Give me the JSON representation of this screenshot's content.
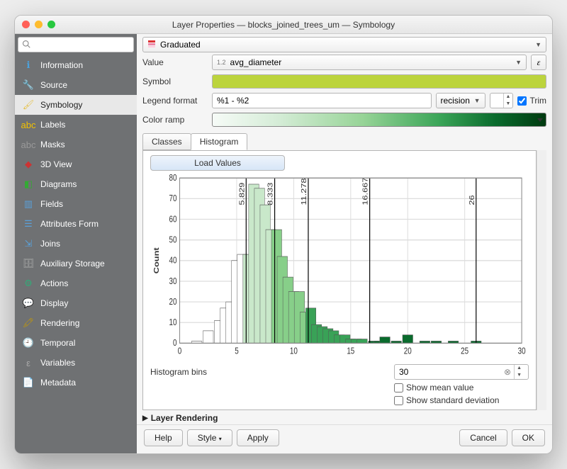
{
  "window": {
    "title": "Layer Properties — blocks_joined_trees_um — Symbology"
  },
  "search": {
    "placeholder": ""
  },
  "sidebar": {
    "items": [
      {
        "label": "Information",
        "icon": "ℹ",
        "bg": "#4aa3df"
      },
      {
        "label": "Source",
        "icon": "🔧",
        "bg": "#888"
      },
      {
        "label": "Symbology",
        "icon": "🖌",
        "bg": "#e6c24a",
        "selected": true
      },
      {
        "label": "Labels",
        "icon": "abc",
        "bg": "#f3c200"
      },
      {
        "label": "Masks",
        "icon": "abc",
        "bg": "#999"
      },
      {
        "label": "3D View",
        "icon": "◆",
        "bg": "#c33"
      },
      {
        "label": "Diagrams",
        "icon": "◧",
        "bg": "#3a3"
      },
      {
        "label": "Fields",
        "icon": "▥",
        "bg": "#5aa0d8"
      },
      {
        "label": "Attributes Form",
        "icon": "☰",
        "bg": "#5aa0d8"
      },
      {
        "label": "Joins",
        "icon": "⇲",
        "bg": "#5aa0d8"
      },
      {
        "label": "Auxiliary Storage",
        "icon": "🗄",
        "bg": "#aaa"
      },
      {
        "label": "Actions",
        "icon": "⚙",
        "bg": "#3a7"
      },
      {
        "label": "Display",
        "icon": "💬",
        "bg": "#f0b000"
      },
      {
        "label": "Rendering",
        "icon": "🖍",
        "bg": "#c89b00"
      },
      {
        "label": "Temporal",
        "icon": "🕘",
        "bg": "#aaa"
      },
      {
        "label": "Variables",
        "icon": "ε",
        "bg": "#aaa"
      },
      {
        "label": "Metadata",
        "icon": "📄",
        "bg": "#aaa"
      }
    ]
  },
  "renderer": {
    "type": "Graduated"
  },
  "rows": {
    "value_label": "Value",
    "value_field": "avg_diameter",
    "value_prefix": "1.2",
    "symbol_label": "Symbol",
    "legend_label": "Legend format",
    "legend_value": "%1 - %2",
    "precision_combo": "recision",
    "precision_value": "",
    "trim_label": "Trim",
    "ramp_label": "Color ramp"
  },
  "tabs": {
    "classes": "Classes",
    "histogram": "Histogram"
  },
  "hist": {
    "load_label": "Load Values",
    "ylabel": "Count",
    "bins_label": "Histogram bins",
    "bins_value": "30",
    "show_mean": "Show mean value",
    "show_std": "Show standard deviation",
    "breaks": [
      {
        "v": 5.829,
        "label": "5.829"
      },
      {
        "v": 8.333,
        "label": "8.333"
      },
      {
        "v": 11.278,
        "label": "11.278"
      },
      {
        "v": 16.667,
        "label": "16.667"
      },
      {
        "v": 26,
        "label": "26"
      }
    ]
  },
  "chart_data": {
    "type": "bar",
    "xlabel": "",
    "ylabel": "Count",
    "xlim": [
      0,
      30
    ],
    "ylim": [
      0,
      80
    ],
    "xticks": [
      0,
      5,
      10,
      15,
      20,
      25,
      30
    ],
    "yticks": [
      0,
      10,
      20,
      30,
      40,
      50,
      60,
      70,
      80
    ],
    "bars": [
      {
        "x": 0.5,
        "count": 0
      },
      {
        "x": 1.5,
        "count": 1
      },
      {
        "x": 2.5,
        "count": 6
      },
      {
        "x": 3.5,
        "count": 11
      },
      {
        "x": 4.0,
        "count": 17
      },
      {
        "x": 4.5,
        "count": 20
      },
      {
        "x": 5.0,
        "count": 40
      },
      {
        "x": 5.5,
        "count": 43
      },
      {
        "x": 6.0,
        "count": 43
      },
      {
        "x": 6.5,
        "count": 77
      },
      {
        "x": 7.0,
        "count": 75
      },
      {
        "x": 7.5,
        "count": 67
      },
      {
        "x": 8.0,
        "count": 55
      },
      {
        "x": 8.5,
        "count": 55
      },
      {
        "x": 9.0,
        "count": 42
      },
      {
        "x": 9.5,
        "count": 32
      },
      {
        "x": 10.0,
        "count": 25
      },
      {
        "x": 10.5,
        "count": 25
      },
      {
        "x": 11.0,
        "count": 15
      },
      {
        "x": 11.5,
        "count": 17
      },
      {
        "x": 12.0,
        "count": 9
      },
      {
        "x": 12.5,
        "count": 8
      },
      {
        "x": 13.0,
        "count": 7
      },
      {
        "x": 13.5,
        "count": 6
      },
      {
        "x": 14.0,
        "count": 4
      },
      {
        "x": 14.5,
        "count": 4
      },
      {
        "x": 15.0,
        "count": 2
      },
      {
        "x": 15.5,
        "count": 2
      },
      {
        "x": 16.0,
        "count": 2
      },
      {
        "x": 17.0,
        "count": 1
      },
      {
        "x": 17.5,
        "count": 1
      },
      {
        "x": 18.0,
        "count": 3
      },
      {
        "x": 19.0,
        "count": 1
      },
      {
        "x": 20.0,
        "count": 4
      },
      {
        "x": 21.5,
        "count": 1
      },
      {
        "x": 22.5,
        "count": 1
      },
      {
        "x": 24.0,
        "count": 1
      },
      {
        "x": 26.0,
        "count": 1
      }
    ],
    "class_breaks": [
      5.829,
      8.333,
      11.278,
      16.667,
      26
    ],
    "class_colors": [
      "#ffffff",
      "#c9e8ca",
      "#87cf89",
      "#39a257",
      "#0a6b2d"
    ]
  },
  "section": {
    "layer_rendering": "Layer Rendering"
  },
  "footer": {
    "help": "Help",
    "style": "Style",
    "apply": "Apply",
    "cancel": "Cancel",
    "ok": "OK"
  }
}
